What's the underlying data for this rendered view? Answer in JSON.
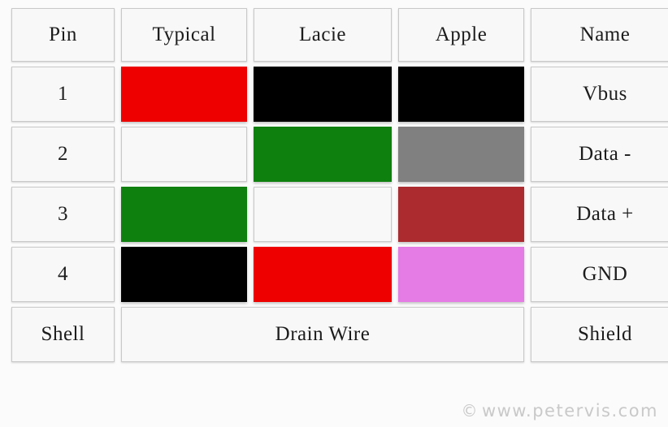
{
  "table": {
    "columns": [
      "Pin",
      "Typical",
      "Lacie",
      "Apple",
      "Name"
    ],
    "rows": [
      {
        "pin": "1",
        "typical": {
          "type": "color",
          "value": "#ee0000",
          "label": "red"
        },
        "lacie": {
          "type": "color",
          "value": "#000000",
          "label": "black"
        },
        "apple": {
          "type": "color",
          "value": "#000000",
          "label": "black"
        },
        "name": "Vbus"
      },
      {
        "pin": "2",
        "typical": {
          "type": "color",
          "value": "#f8f8f8",
          "label": "white"
        },
        "lacie": {
          "type": "color",
          "value": "#0e800e",
          "label": "green"
        },
        "apple": {
          "type": "color",
          "value": "#808080",
          "label": "gray"
        },
        "name": "Data -"
      },
      {
        "pin": "3",
        "typical": {
          "type": "color",
          "value": "#0e800e",
          "label": "green"
        },
        "lacie": {
          "type": "color",
          "value": "#f8f8f8",
          "label": "white"
        },
        "apple": {
          "type": "color",
          "value": "#ab2b2f",
          "label": "dark red"
        },
        "name": "Data +"
      },
      {
        "pin": "4",
        "typical": {
          "type": "color",
          "value": "#000000",
          "label": "black"
        },
        "lacie": {
          "type": "color",
          "value": "#ee0000",
          "label": "red"
        },
        "apple": {
          "type": "color",
          "value": "#e57be5",
          "label": "violet"
        },
        "name": "GND"
      }
    ],
    "shell_row": {
      "pin": "Shell",
      "drain": "Drain Wire",
      "name": "Shield"
    }
  },
  "watermark": {
    "copyright_symbol": "©",
    "text": "www.petervis.com"
  },
  "colors": {
    "page_background": "#fbfbfb",
    "cell_background": "#f8f8f8",
    "cell_border": "#c9c9c9",
    "text": "#1c1c1c",
    "watermark": "#c9c9c9"
  }
}
